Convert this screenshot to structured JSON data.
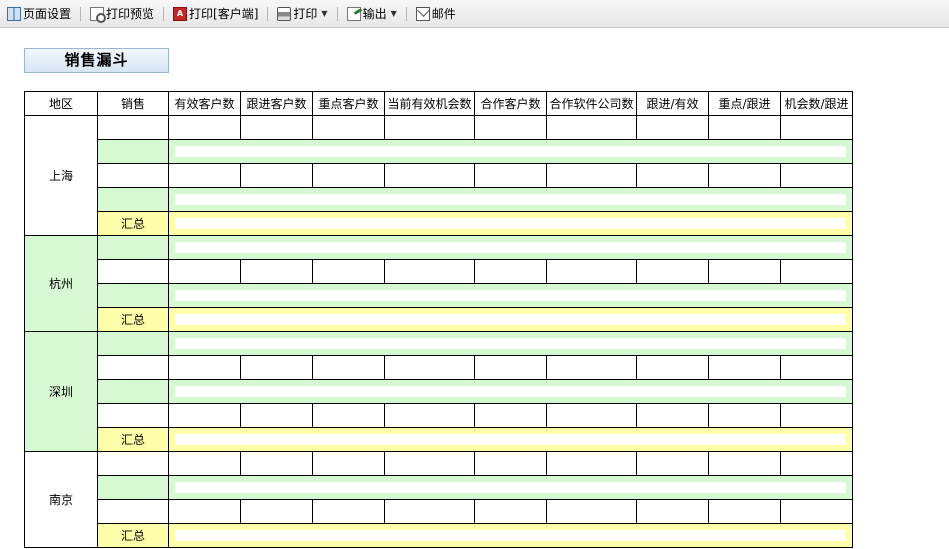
{
  "toolbar": {
    "items": [
      {
        "label": "页面设置",
        "icon": "page-setup-icon"
      },
      {
        "label": "打印预览",
        "icon": "print-preview-icon"
      },
      {
        "label": "打印[客户端]",
        "icon": "pdf-print-icon"
      },
      {
        "label": "打印",
        "icon": "printer-icon",
        "dropdown": true
      },
      {
        "label": "输出",
        "icon": "export-icon",
        "dropdown": true
      },
      {
        "label": "邮件",
        "icon": "mail-icon"
      }
    ]
  },
  "report": {
    "title": "销售漏斗",
    "columns": [
      "地区",
      "销售",
      "有效客户数",
      "跟进客户数",
      "重点客户数",
      "当前有效机会数",
      "合作客户数",
      "合作软件公司数",
      "跟进/有效",
      "重点/跟进",
      "机会数/跟进"
    ],
    "summary_label": "汇总",
    "regions": [
      {
        "name": "上海",
        "bg": "w",
        "rows": [
          "w",
          "g",
          "w",
          "g"
        ]
      },
      {
        "name": "杭州",
        "bg": "g",
        "rows": [
          "g",
          "w",
          "g"
        ]
      },
      {
        "name": "深圳",
        "bg": "g",
        "rows": [
          "g",
          "w",
          "g",
          "w"
        ]
      },
      {
        "name": "南京",
        "bg": "w",
        "rows": [
          "w",
          "g",
          "w"
        ]
      }
    ]
  },
  "colors": {
    "green_row": "#d6f8d2",
    "yellow_row": "#ffffaa",
    "title_border": "#9ab6d0"
  }
}
